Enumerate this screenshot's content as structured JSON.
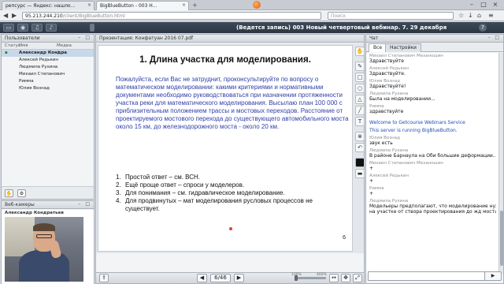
{
  "browser": {
    "tabs": [
      {
        "label": "репсурс — Яндекс: нашло..."
      },
      {
        "label": "BigBlueButton - 003 Н..."
      }
    ],
    "url_host": "95.213.244.210",
    "url_path": "/client/BigBlueButton.html",
    "search_placeholder": "Поиск"
  },
  "bbb": {
    "title": "(Ведется запись) 003 Новый четвертовый вебинар. 7. 29 декабря"
  },
  "users": {
    "header": "Пользователи",
    "columns": {
      "status": "Статус",
      "name": "Имя",
      "media": "Медиа"
    },
    "rows": [
      {
        "name": "Александр Кондра",
        "selected": true
      },
      {
        "name": "Алексей Редькин",
        "selected": false
      },
      {
        "name": "Людмила Рухина",
        "selected": false
      },
      {
        "name": "Михаил Степанович",
        "selected": false
      },
      {
        "name": "Римма",
        "selected": false
      },
      {
        "name": "Юлия Вознад",
        "selected": false
      }
    ]
  },
  "webcam": {
    "header": "Веб-камеры",
    "name": "Александр Кондратьев"
  },
  "presentation": {
    "header": "Презентация: Конфатуан 2016 07.pdf",
    "title": "1. Длина участка для моделирования.",
    "paragraph": "Пожалуйста, если Вас не затруднит, проконсультируйте по вопросу о математическом моделировании: какими критериями и нормативными документами необходимо руководствоваться при назначении протяженности участка реки для математического моделирования. Высылаю план 100 000 с приблизительным положением трассы и мостовых переходов. Расстояние от проектируемого мостового перехода до существующего автомобильного моста около 15 км, до железнодорожного моста - около 20 км.",
    "list": [
      {
        "n": "1.",
        "text": "Простой ответ – см. ВСН."
      },
      {
        "n": "2.",
        "text": "Ещё проще ответ – спроси у моделеров."
      },
      {
        "n": "3.",
        "text": "Для понимания – см. гидравлическое моделирование."
      },
      {
        "n": "4.",
        "text": "Для продвинутых – мат моделирования русловых процессов не существует."
      }
    ],
    "page_number": "6",
    "page_indicator": "6/46",
    "zoom_min": "100%",
    "zoom_max": "400%"
  },
  "chat": {
    "header": "Чат",
    "tabs": [
      "Все",
      "Настройки"
    ],
    "messages": [
      {
        "who": "Михаил Степанович Механошин",
        "text": "Здравствуйте",
        "style": "plain"
      },
      {
        "who": "Алексей Редькин",
        "text": "Здравствуйте.",
        "style": "plain"
      },
      {
        "who": "Юлия Вознад",
        "text": "Здравствуйте!",
        "style": "plain"
      },
      {
        "who": "Людмила Рухина",
        "text": "Была на моделировании...",
        "style": "plain"
      },
      {
        "who": "Римма",
        "text": "здравствуйте",
        "style": "plain"
      },
      {
        "who": "",
        "text": "Welcome to Getcourse Webinars Service",
        "style": "blue"
      },
      {
        "who": "",
        "text": "This server is running BigBlueButton.",
        "style": "blue"
      },
      {
        "who": "Юлия Вознад",
        "text": "звук есть",
        "style": "plain"
      },
      {
        "who": "Людмила Рухина",
        "text": "В районе Барнаула на Оби большие деформации...+",
        "style": "plain"
      },
      {
        "who": "Михаил Степанович Механошин",
        "text": "+",
        "style": "plain"
      },
      {
        "who": "Алексей Редькин",
        "text": "+",
        "style": "plain"
      },
      {
        "who": "Римма",
        "text": "+",
        "style": "plain"
      },
      {
        "who": "Людмила Рухина",
        "text": "Модельеры предполагают, что моделирование нужно произ",
        "style": "plain"
      },
      {
        "who": "",
        "text": "на участке от створа проектирования до жд моста - это 2",
        "style": "plain"
      }
    ],
    "send_label": "▶"
  }
}
